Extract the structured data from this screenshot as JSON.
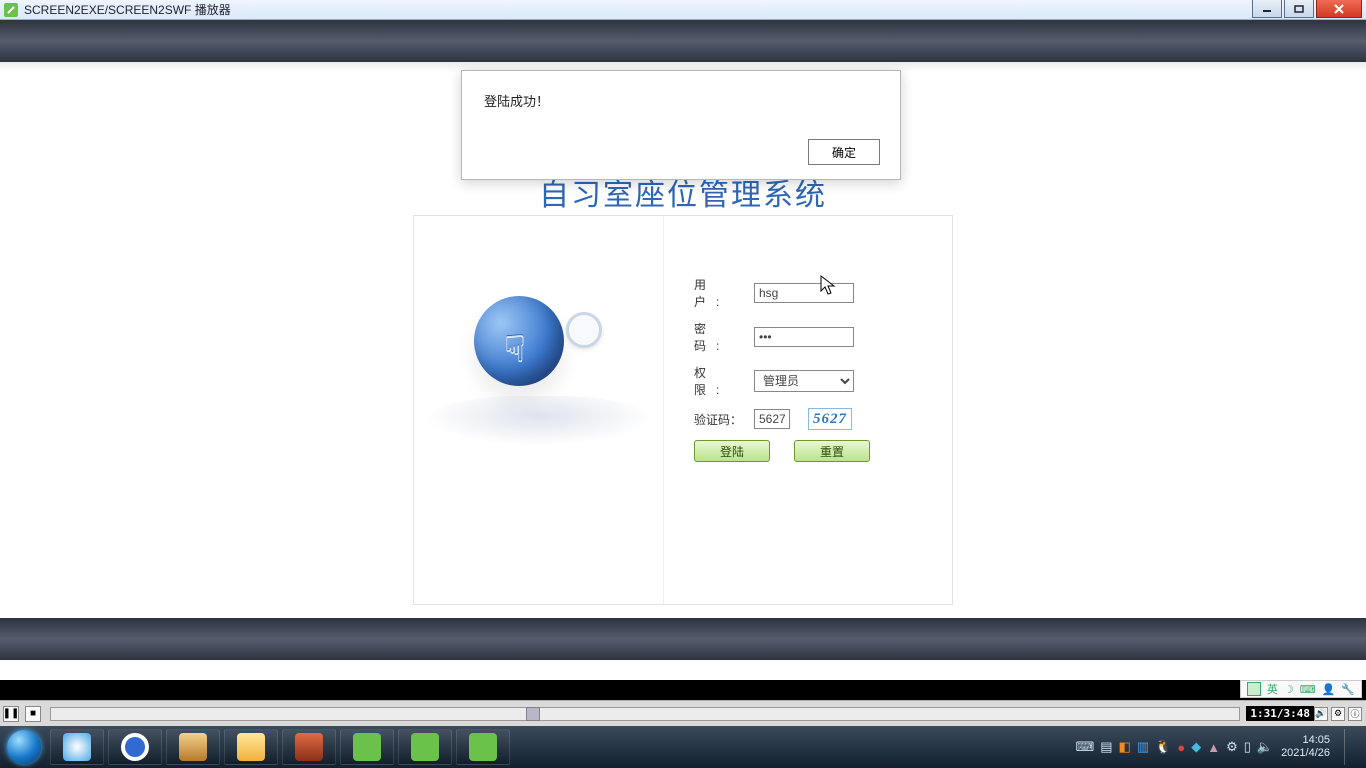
{
  "window": {
    "title": "SCREEN2EXE/SCREEN2SWF 播放器"
  },
  "app": {
    "title": "自习室座位管理系统"
  },
  "dialog": {
    "message": "登陆成功！",
    "ok": "确定"
  },
  "form": {
    "user_label": "用　户:",
    "user_value": "hsg",
    "pass_label": "密　码:",
    "pass_value": "•••",
    "role_label": "权　限:",
    "role_value": "管理员",
    "captcha_label": "验证码：",
    "captcha_value": "5627",
    "captcha_image": "5627",
    "login_btn": "登陆",
    "reset_btn": "重置"
  },
  "player": {
    "time": "1:31/3:48"
  },
  "ime": {
    "label": "英"
  },
  "tray": {
    "time": "14:05",
    "date": "2021/4/26"
  }
}
